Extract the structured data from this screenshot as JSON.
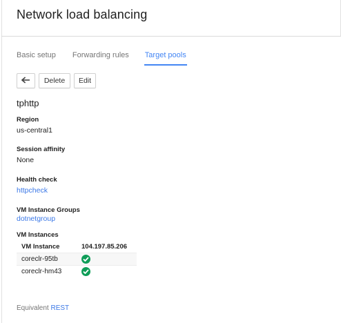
{
  "header": {
    "title": "Network load balancing"
  },
  "tabs": [
    {
      "label": "Basic setup"
    },
    {
      "label": "Forwarding rules"
    },
    {
      "label": "Target pools"
    }
  ],
  "toolbar": {
    "back_icon": "back-arrow-icon",
    "delete_label": "Delete",
    "edit_label": "Edit"
  },
  "pool": {
    "name": "tphttp",
    "region_label": "Region",
    "region_value": "us-central1",
    "session_label": "Session affinity",
    "session_value": "None",
    "health_label": "Health check",
    "health_value": "httpcheck",
    "groups_label": "VM Instance Groups",
    "groups_value": "dotnetgroup",
    "instances_label": "VM Instances"
  },
  "vm_table": {
    "headers": [
      "VM Instance",
      "104.197.85.206"
    ],
    "rows": [
      {
        "name": "coreclr-95tb",
        "status_icon": "check-circle-icon"
      },
      {
        "name": "coreclr-hm43",
        "status_icon": "check-circle-icon"
      }
    ]
  },
  "footer": {
    "prefix": "Equivalent",
    "link": "REST"
  },
  "colors": {
    "accent": "#4285f4",
    "link": "#3b78e7",
    "success": "#0f9d58"
  }
}
